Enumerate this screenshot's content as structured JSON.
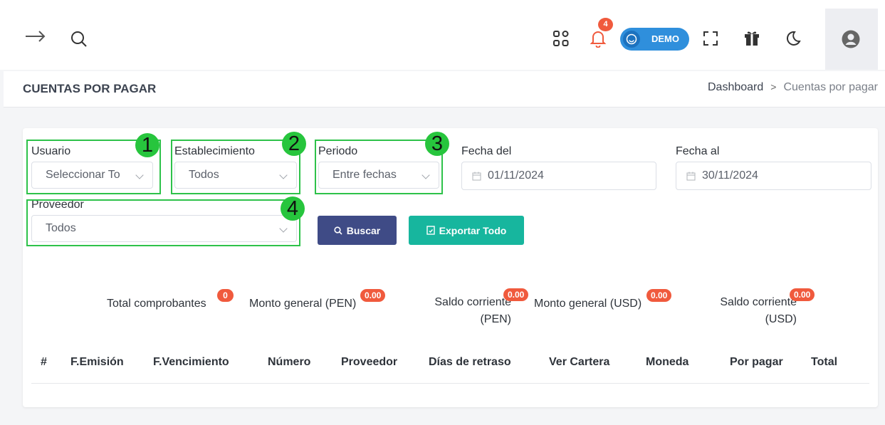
{
  "topbar": {
    "notifications_count": "4",
    "demo_label": "DEMO"
  },
  "header": {
    "title": "CUENTAS POR PAGAR",
    "breadcrumb": [
      "Dashboard",
      "Cuentas por pagar"
    ],
    "breadcrumb_sep": ">"
  },
  "filters": {
    "usuario": {
      "label": "Usuario",
      "value": "Seleccionar To"
    },
    "establecimiento": {
      "label": "Establecimiento",
      "value": "Todos"
    },
    "periodo": {
      "label": "Periodo",
      "value": "Entre fechas"
    },
    "fecha_del": {
      "label": "Fecha del",
      "value": "01/11/2024"
    },
    "fecha_al": {
      "label": "Fecha al",
      "value": "30/11/2024"
    },
    "proveedor": {
      "label": "Proveedor",
      "value": "Todos"
    }
  },
  "annotations": [
    "1",
    "2",
    "3",
    "4"
  ],
  "buttons": {
    "buscar": "Buscar",
    "exportar": "Exportar Todo"
  },
  "stats": [
    {
      "label": "Total comprobantes",
      "badge": "0"
    },
    {
      "label": "Monto general (PEN)",
      "badge": "0.00"
    },
    {
      "label_line1": "Saldo corriente",
      "label_line2": "(PEN)",
      "badge": "0.00"
    },
    {
      "label": "Monto general (USD)",
      "badge": "0.00"
    },
    {
      "label_line1": "Saldo corriente",
      "label_line2": "(USD)",
      "badge": "0.00"
    }
  ],
  "table": {
    "columns": [
      "#",
      "F.Emisión",
      "F.Vencimiento",
      "Número",
      "Proveedor",
      "Días de retraso",
      "Ver Cartera",
      "Moneda",
      "Por pagar",
      "Total"
    ]
  },
  "colors": {
    "primary": "#3f4b86",
    "success": "#17b69e",
    "badge": "#f05a3d",
    "highlight": "#2ec24a",
    "demo": "#2f8fdc"
  }
}
